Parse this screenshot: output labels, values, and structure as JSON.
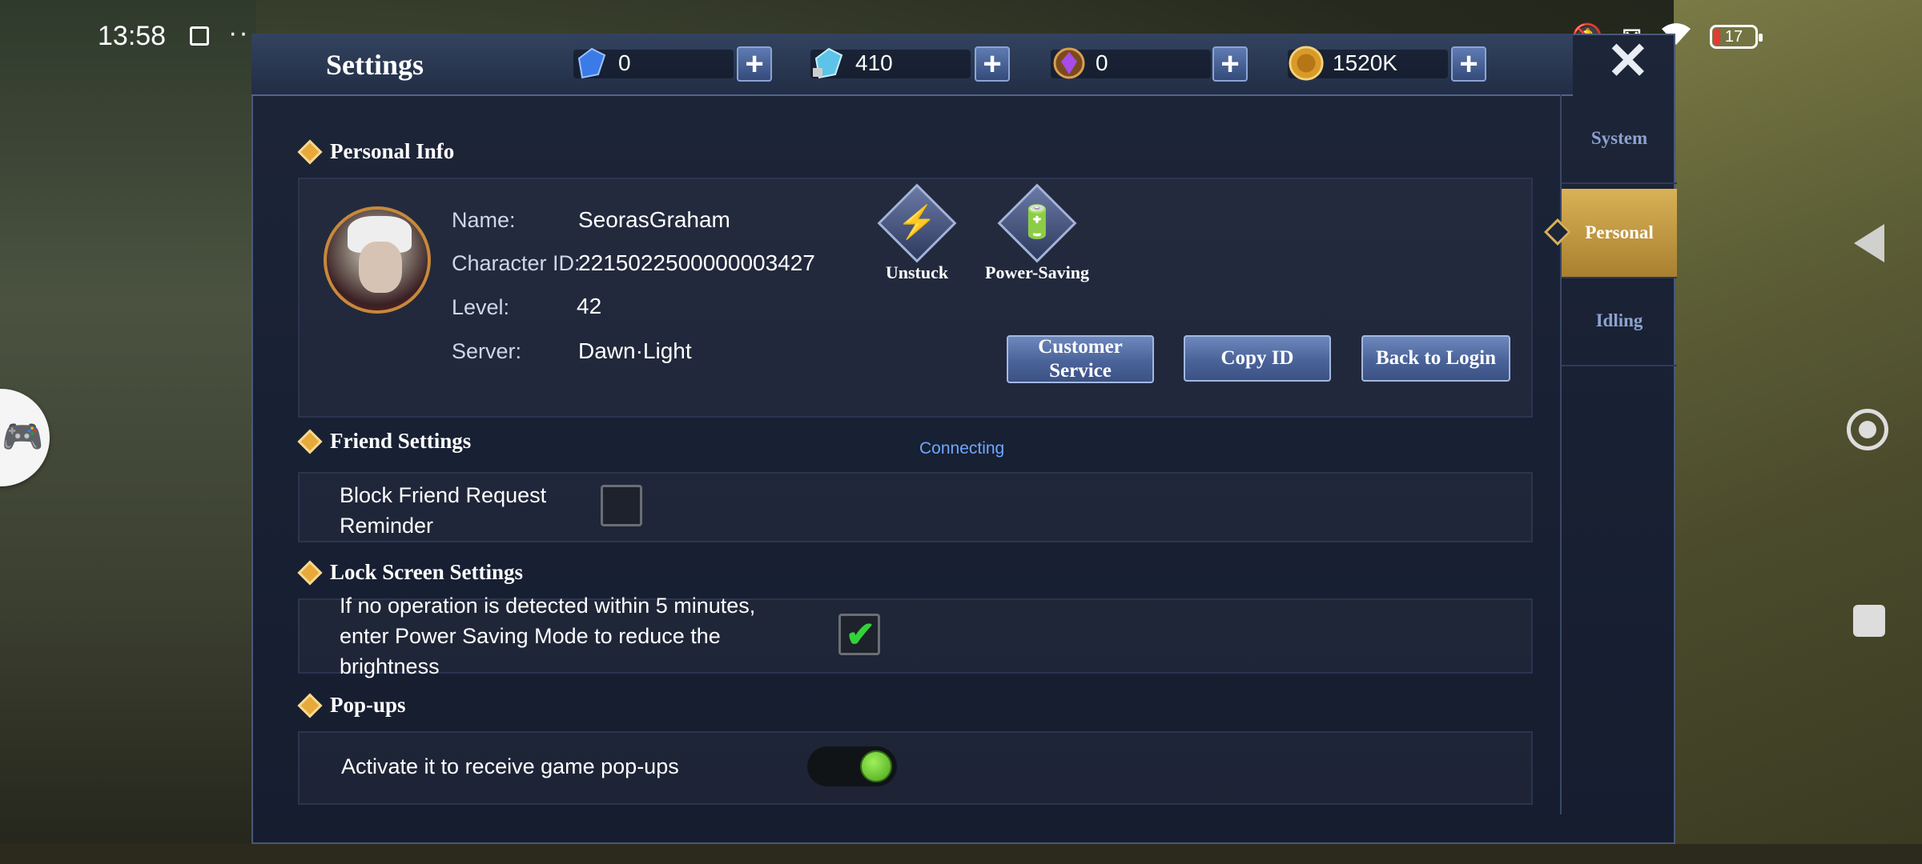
{
  "status_bar": {
    "time": "13:58",
    "dots": "··",
    "battery": "17",
    "icons": [
      "screenshot-icon",
      "mute-icon",
      "sim-off-icon",
      "wifi-icon",
      "battery-icon"
    ]
  },
  "header": {
    "title": "Settings",
    "currencies": [
      {
        "icon": "blue-diamond-icon",
        "value": "0"
      },
      {
        "icon": "locked-diamond-icon",
        "value": "410"
      },
      {
        "icon": "purple-gem-icon",
        "value": "0"
      },
      {
        "icon": "gold-coin-icon",
        "value": "1520K"
      }
    ],
    "plus": "+",
    "close": "✕"
  },
  "side_tabs": [
    {
      "label": "System",
      "active": false
    },
    {
      "label": "Personal",
      "active": true
    },
    {
      "label": "Idling",
      "active": false
    }
  ],
  "personal_info": {
    "header": "Personal Info",
    "name_label": "Name:",
    "name": "SeorasGraham",
    "id_label": "Character ID:",
    "id": "2215022500000003427",
    "level_label": "Level:",
    "level": "42",
    "server_label": "Server:",
    "server": "Dawn·Light",
    "unstuck": "Unstuck",
    "power_saving": "Power-Saving",
    "customer_service_1": "Customer",
    "customer_service_2": "Service",
    "copy_id": "Copy ID",
    "back_to_login": "Back to Login"
  },
  "friend_settings": {
    "header": "Friend Settings",
    "connecting": "Connecting",
    "block_line1": "Block Friend Request",
    "block_line2": "Reminder",
    "block_checked": false
  },
  "lock_screen": {
    "header": "Lock Screen Settings",
    "line1": "If no operation is detected within 5 minutes,",
    "line2": "enter Power Saving Mode to reduce the",
    "line3": "brightness",
    "checked": true,
    "check": "✔"
  },
  "popups": {
    "header": "Pop-ups",
    "label": "Activate it to receive game pop-ups",
    "enabled": true
  },
  "colors": {
    "accent_gold": "#d9b156",
    "button_blue": "#4a6399",
    "check_green": "#34d23a",
    "connecting_blue": "#6ea8ff"
  }
}
